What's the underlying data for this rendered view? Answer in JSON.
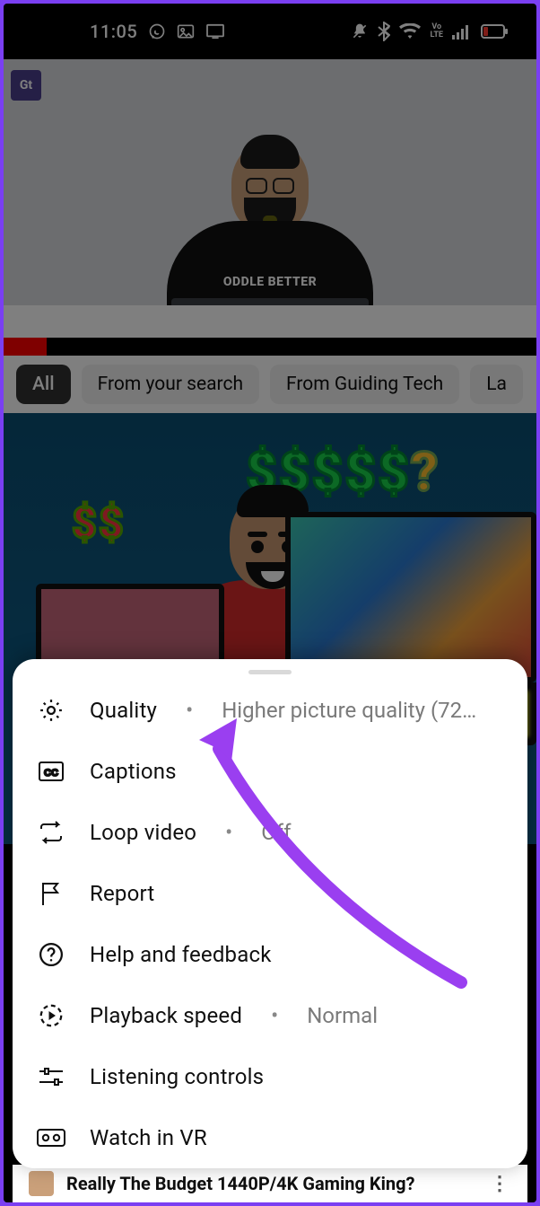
{
  "status": {
    "time": "11:05",
    "volte": "Vo\nLTE"
  },
  "video": {
    "channel_badge": "Gt",
    "shirt_text": "ODDLE BETTER"
  },
  "chips": [
    {
      "label": "All",
      "selected": true
    },
    {
      "label": "From your search",
      "selected": false
    },
    {
      "label": "From Guiding Tech",
      "selected": false
    },
    {
      "label": "La",
      "selected": false
    }
  ],
  "thumb": {
    "cash_small": "$$",
    "cash_big": "$$$$$",
    "qmark": "?"
  },
  "sheet": {
    "items": [
      {
        "icon": "gear",
        "label": "Quality",
        "value": "Higher picture quality (72…"
      },
      {
        "icon": "cc",
        "label": "Captions",
        "value": null
      },
      {
        "icon": "loop",
        "label": "Loop video",
        "value": "Off"
      },
      {
        "icon": "flag",
        "label": "Report",
        "value": null
      },
      {
        "icon": "help",
        "label": "Help and feedback",
        "value": null
      },
      {
        "icon": "speed",
        "label": "Playback speed",
        "value": "Normal"
      },
      {
        "icon": "sliders",
        "label": "Listening controls",
        "value": null
      },
      {
        "icon": "vr",
        "label": "Watch in VR",
        "value": null
      }
    ]
  },
  "peek": {
    "title": "Really The Budget 1440P/4K Gaming King?"
  }
}
